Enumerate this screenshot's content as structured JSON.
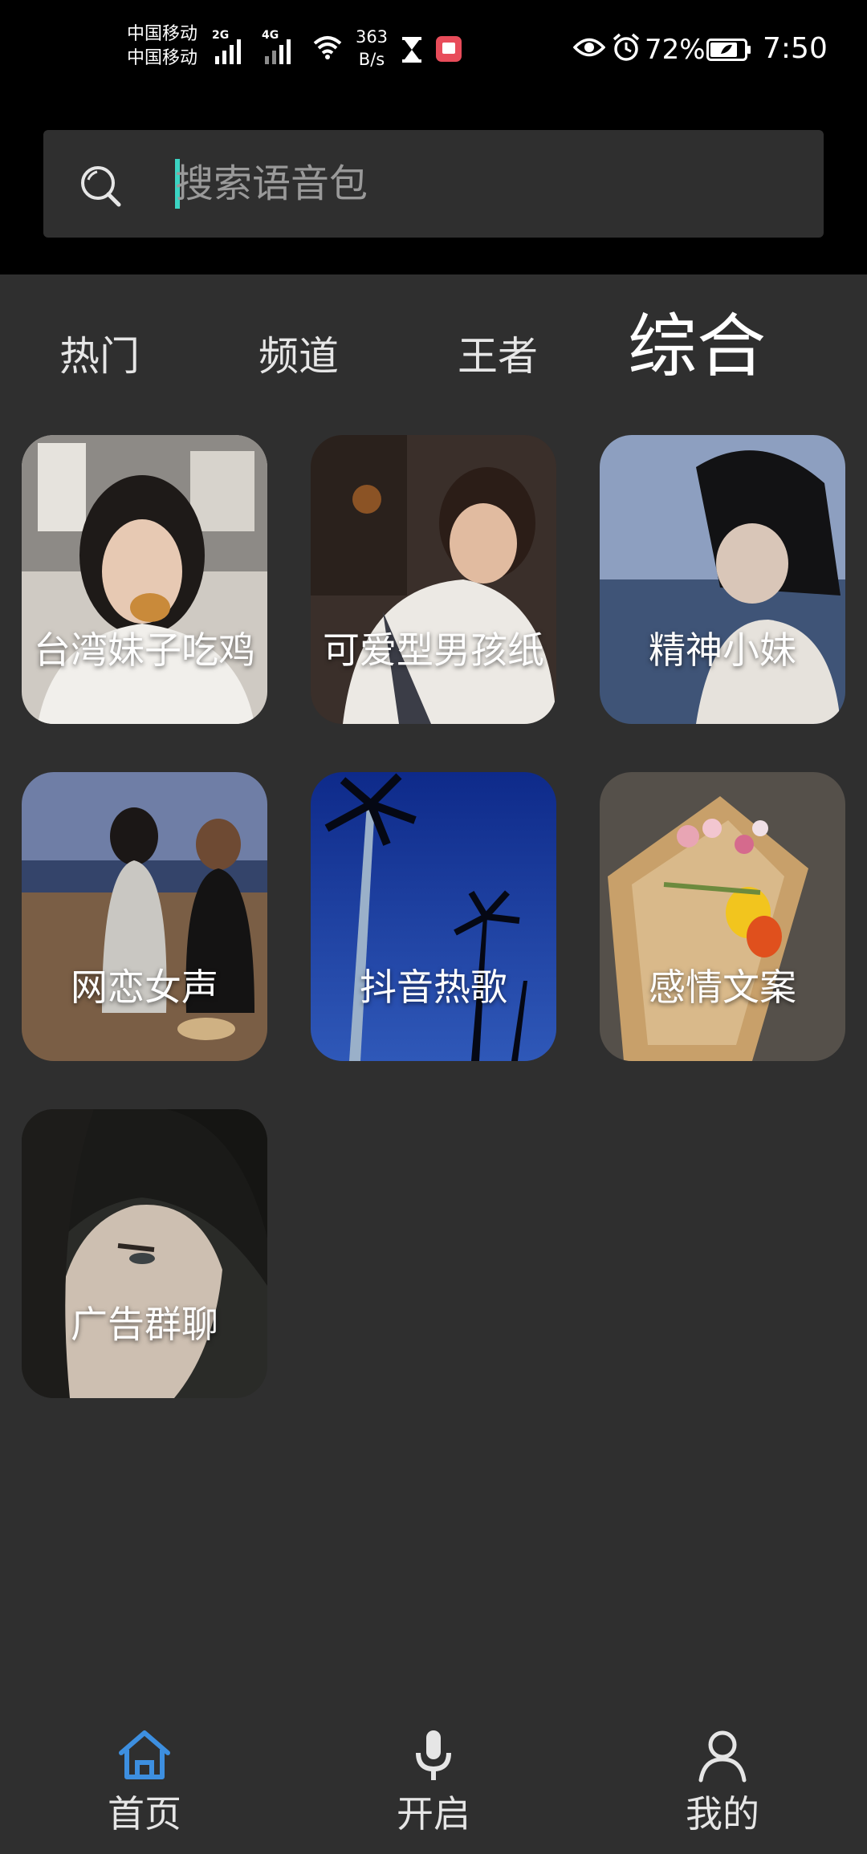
{
  "status_bar": {
    "carrier_1": "中国移动",
    "carrier_2": "中国移动",
    "network_1": "2G",
    "network_2": "4G",
    "net_speed_value": "363",
    "net_speed_unit": "B/s",
    "battery_percent": "72%",
    "time": "7:50",
    "icons": [
      "signal-icon",
      "wifi-icon",
      "hourglass-icon",
      "app-notification-icon",
      "eye-icon",
      "alarm-icon",
      "battery-icon"
    ]
  },
  "search": {
    "placeholder": "搜索语音包",
    "value": "",
    "icon": "search-icon"
  },
  "tabs": [
    {
      "label": "热门",
      "active": false
    },
    {
      "label": "频道",
      "active": false
    },
    {
      "label": "王者",
      "active": false
    },
    {
      "label": "综合",
      "active": true
    }
  ],
  "cards": [
    {
      "label": "台湾妹子吃鸡"
    },
    {
      "label": "可爱型男孩纸"
    },
    {
      "label": "精神小妹"
    },
    {
      "label": "网恋女声"
    },
    {
      "label": "抖音热歌"
    },
    {
      "label": "感情文案"
    },
    {
      "label": "广告群聊"
    }
  ],
  "bottom_nav": [
    {
      "label": "首页",
      "icon": "home-icon",
      "active": true
    },
    {
      "label": "开启",
      "icon": "microphone-icon",
      "active": false
    },
    {
      "label": "我的",
      "icon": "profile-icon",
      "active": false
    }
  ],
  "colors": {
    "background": "#2f2f2f",
    "header_background": "#000000",
    "accent": "#3d8fe0",
    "cursor": "#3bd3c2",
    "text": "#ffffff",
    "placeholder": "#9a9a9a"
  }
}
